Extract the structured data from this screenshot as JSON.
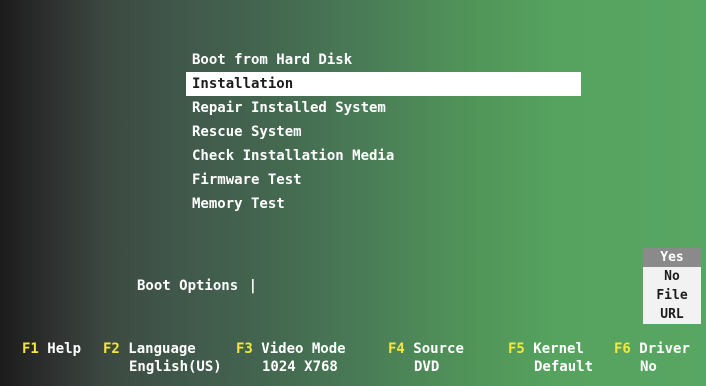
{
  "menu": {
    "items": [
      {
        "label": "Boot from Hard Disk",
        "selected": false
      },
      {
        "label": "Installation",
        "selected": true
      },
      {
        "label": "Repair Installed System",
        "selected": false
      },
      {
        "label": "Rescue System",
        "selected": false
      },
      {
        "label": "Check Installation Media",
        "selected": false
      },
      {
        "label": "Firmware Test",
        "selected": false
      },
      {
        "label": "Memory Test",
        "selected": false
      }
    ]
  },
  "boot_options": {
    "label": "Boot Options",
    "cursor": "|"
  },
  "driver_popup": {
    "options": [
      "Yes",
      "No",
      "File",
      "URL"
    ],
    "selected": "Yes"
  },
  "fkeys": [
    {
      "key": "F1",
      "label": "Help",
      "value": ""
    },
    {
      "key": "F2",
      "label": "Language",
      "value": "English(US)"
    },
    {
      "key": "F3",
      "label": "Video Mode",
      "value": "1024 X768"
    },
    {
      "key": "F4",
      "label": "Source",
      "value": "DVD"
    },
    {
      "key": "F5",
      "label": "Kernel",
      "value": "Default"
    },
    {
      "key": "F6",
      "label": "Driver",
      "value": "No"
    }
  ],
  "colors": {
    "key_color": "#f4e63a",
    "selection_background": "#ffffff",
    "popup_selected_background": "#8a8a8a"
  }
}
